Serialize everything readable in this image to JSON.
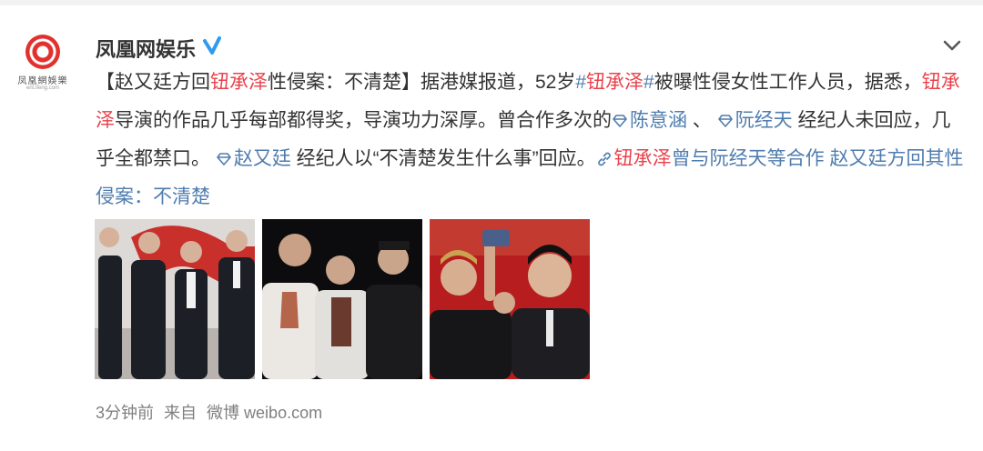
{
  "account": {
    "name": "凤凰网娱乐",
    "logo_text": "凤凰網娛樂",
    "logo_subtext": "ent.ifeng.com"
  },
  "post": {
    "title_bracket_open": "【",
    "title_part1": "赵又廷方回",
    "title_name": "钮承泽",
    "title_part2": "性侵案：不清楚",
    "title_bracket_close": "】",
    "seg1": "据港媒报道，52岁",
    "hashtag": "#钮承泽#",
    "seg2": "被曝性侵女性工作人员，据悉，",
    "name_inline": "钮承泽",
    "seg3": "导演的作品几乎每部都得奖，导演功力深厚。曾合作多次的",
    "mention1": "陈意涵",
    "sep1": " 、",
    "mention2": "阮经天",
    "seg4": " 经纪人未回应，几乎全都禁口。",
    "mention3": "赵又廷",
    "seg5": " 经纪人以“不清楚发生什么事”回应。",
    "link_name": "钮承泽",
    "link_rest": "曾与阮经天等合作 赵又廷方回其性侵案：不清楚"
  },
  "images": [
    {
      "name": "photo-group-four-men"
    },
    {
      "name": "photo-three-men-dark"
    },
    {
      "name": "photo-selfie"
    }
  ],
  "footer": {
    "time": "3分钟前",
    "from_label": "来自",
    "source": "微博 weibo.com"
  },
  "colors": {
    "name_red": "#e8424b",
    "link_blue": "#507daf",
    "meta_gray": "#808080",
    "verified_blue": "#2e9bf0"
  }
}
